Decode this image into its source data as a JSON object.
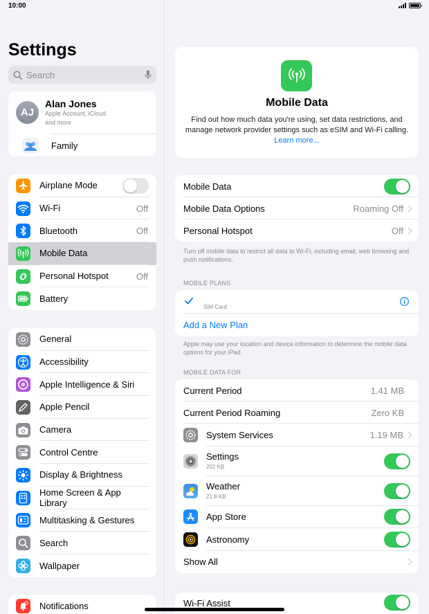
{
  "status": {
    "time": "10:00"
  },
  "sidebar": {
    "title": "Settings",
    "search_placeholder": "Search",
    "profile": {
      "initials": "AJ",
      "name": "Alan Jones",
      "subtitle_1": "Apple Account, iCloud",
      "subtitle_2": "and more",
      "family_label": "Family"
    },
    "group1": [
      {
        "label": "Airplane Mode",
        "value": "",
        "toggle": "off",
        "color": "#ff9500",
        "icon": "airplane-icon"
      },
      {
        "label": "Wi-Fi",
        "value": "Off",
        "color": "#007aff",
        "icon": "wifi-icon"
      },
      {
        "label": "Bluetooth",
        "value": "Off",
        "color": "#007aff",
        "icon": "bluetooth-icon"
      },
      {
        "label": "Mobile Data",
        "value": "",
        "color": "#34c759",
        "icon": "antenna-icon",
        "selected": true
      },
      {
        "label": "Personal Hotspot",
        "value": "Off",
        "color": "#34c759",
        "icon": "hotspot-icon"
      },
      {
        "label": "Battery",
        "value": "",
        "color": "#34c759",
        "icon": "battery-icon"
      }
    ],
    "group2": [
      {
        "label": "General",
        "color": "#8e8e93",
        "icon": "gear-icon"
      },
      {
        "label": "Accessibility",
        "color": "#007aff",
        "icon": "accessibility-icon"
      },
      {
        "label": "Apple Intelligence & Siri",
        "color": "#af52de",
        "icon": "siri-icon"
      },
      {
        "label": "Apple Pencil",
        "color": "#636366",
        "icon": "pencil-icon"
      },
      {
        "label": "Camera",
        "color": "#8e8e93",
        "icon": "camera-icon"
      },
      {
        "label": "Control Centre",
        "color": "#8e8e93",
        "icon": "control-centre-icon"
      },
      {
        "label": "Display & Brightness",
        "color": "#007aff",
        "icon": "brightness-icon"
      },
      {
        "label": "Home Screen & App Library",
        "color": "#007aff",
        "icon": "home-screen-icon"
      },
      {
        "label": "Multitasking & Gestures",
        "color": "#007aff",
        "icon": "multitasking-icon"
      },
      {
        "label": "Search",
        "color": "#8e8e93",
        "icon": "search-icon"
      },
      {
        "label": "Wallpaper",
        "color": "#32ade6",
        "icon": "wallpaper-icon"
      }
    ],
    "group3": [
      {
        "label": "Notifications",
        "color": "#ff3b30",
        "icon": "bell-icon"
      }
    ]
  },
  "main": {
    "hero": {
      "title": "Mobile Data",
      "description": "Find out how much data you're using, set data restrictions, and manage network provider settings such as eSIM and Wi-Fi calling.",
      "link": "Learn more..."
    },
    "group_a": [
      {
        "label": "Mobile Data",
        "toggle": "on"
      },
      {
        "label": "Mobile Data Options",
        "value": "Roaming Off"
      },
      {
        "label": "Personal Hotspot",
        "value": "Off"
      }
    ],
    "note_a": "Turn off mobile data to restrict all data to Wi-Fi, including email, web browsing and push notifications.",
    "plans_header": "MOBILE PLANS",
    "sim_label": "SIM Card",
    "add_plan": "Add a New Plan",
    "note_b": "Apple may use your location and device information to determine the mobile data options for your iPad.",
    "usage_header": "MOBILE DATA FOR",
    "usage": [
      {
        "label": "Current Period",
        "value": "1.41 MB"
      },
      {
        "label": "Current Period Roaming",
        "value": "Zero KB"
      }
    ],
    "apps": [
      {
        "label": "System Services",
        "value": "1.19 MB",
        "icon": "gear-icon"
      },
      {
        "label": "Settings",
        "sub": "202 KB",
        "toggle": "on",
        "icon": "settings-app-icon"
      },
      {
        "label": "Weather",
        "sub": "21.8 KB",
        "toggle": "on",
        "icon": "weather-icon"
      },
      {
        "label": "App Store",
        "toggle": "on",
        "icon": "app-store-icon"
      },
      {
        "label": "Astronomy",
        "toggle": "on",
        "icon": "astronomy-icon"
      }
    ],
    "show_all": "Show All",
    "wifi_assist": "Wi-Fi Assist"
  }
}
